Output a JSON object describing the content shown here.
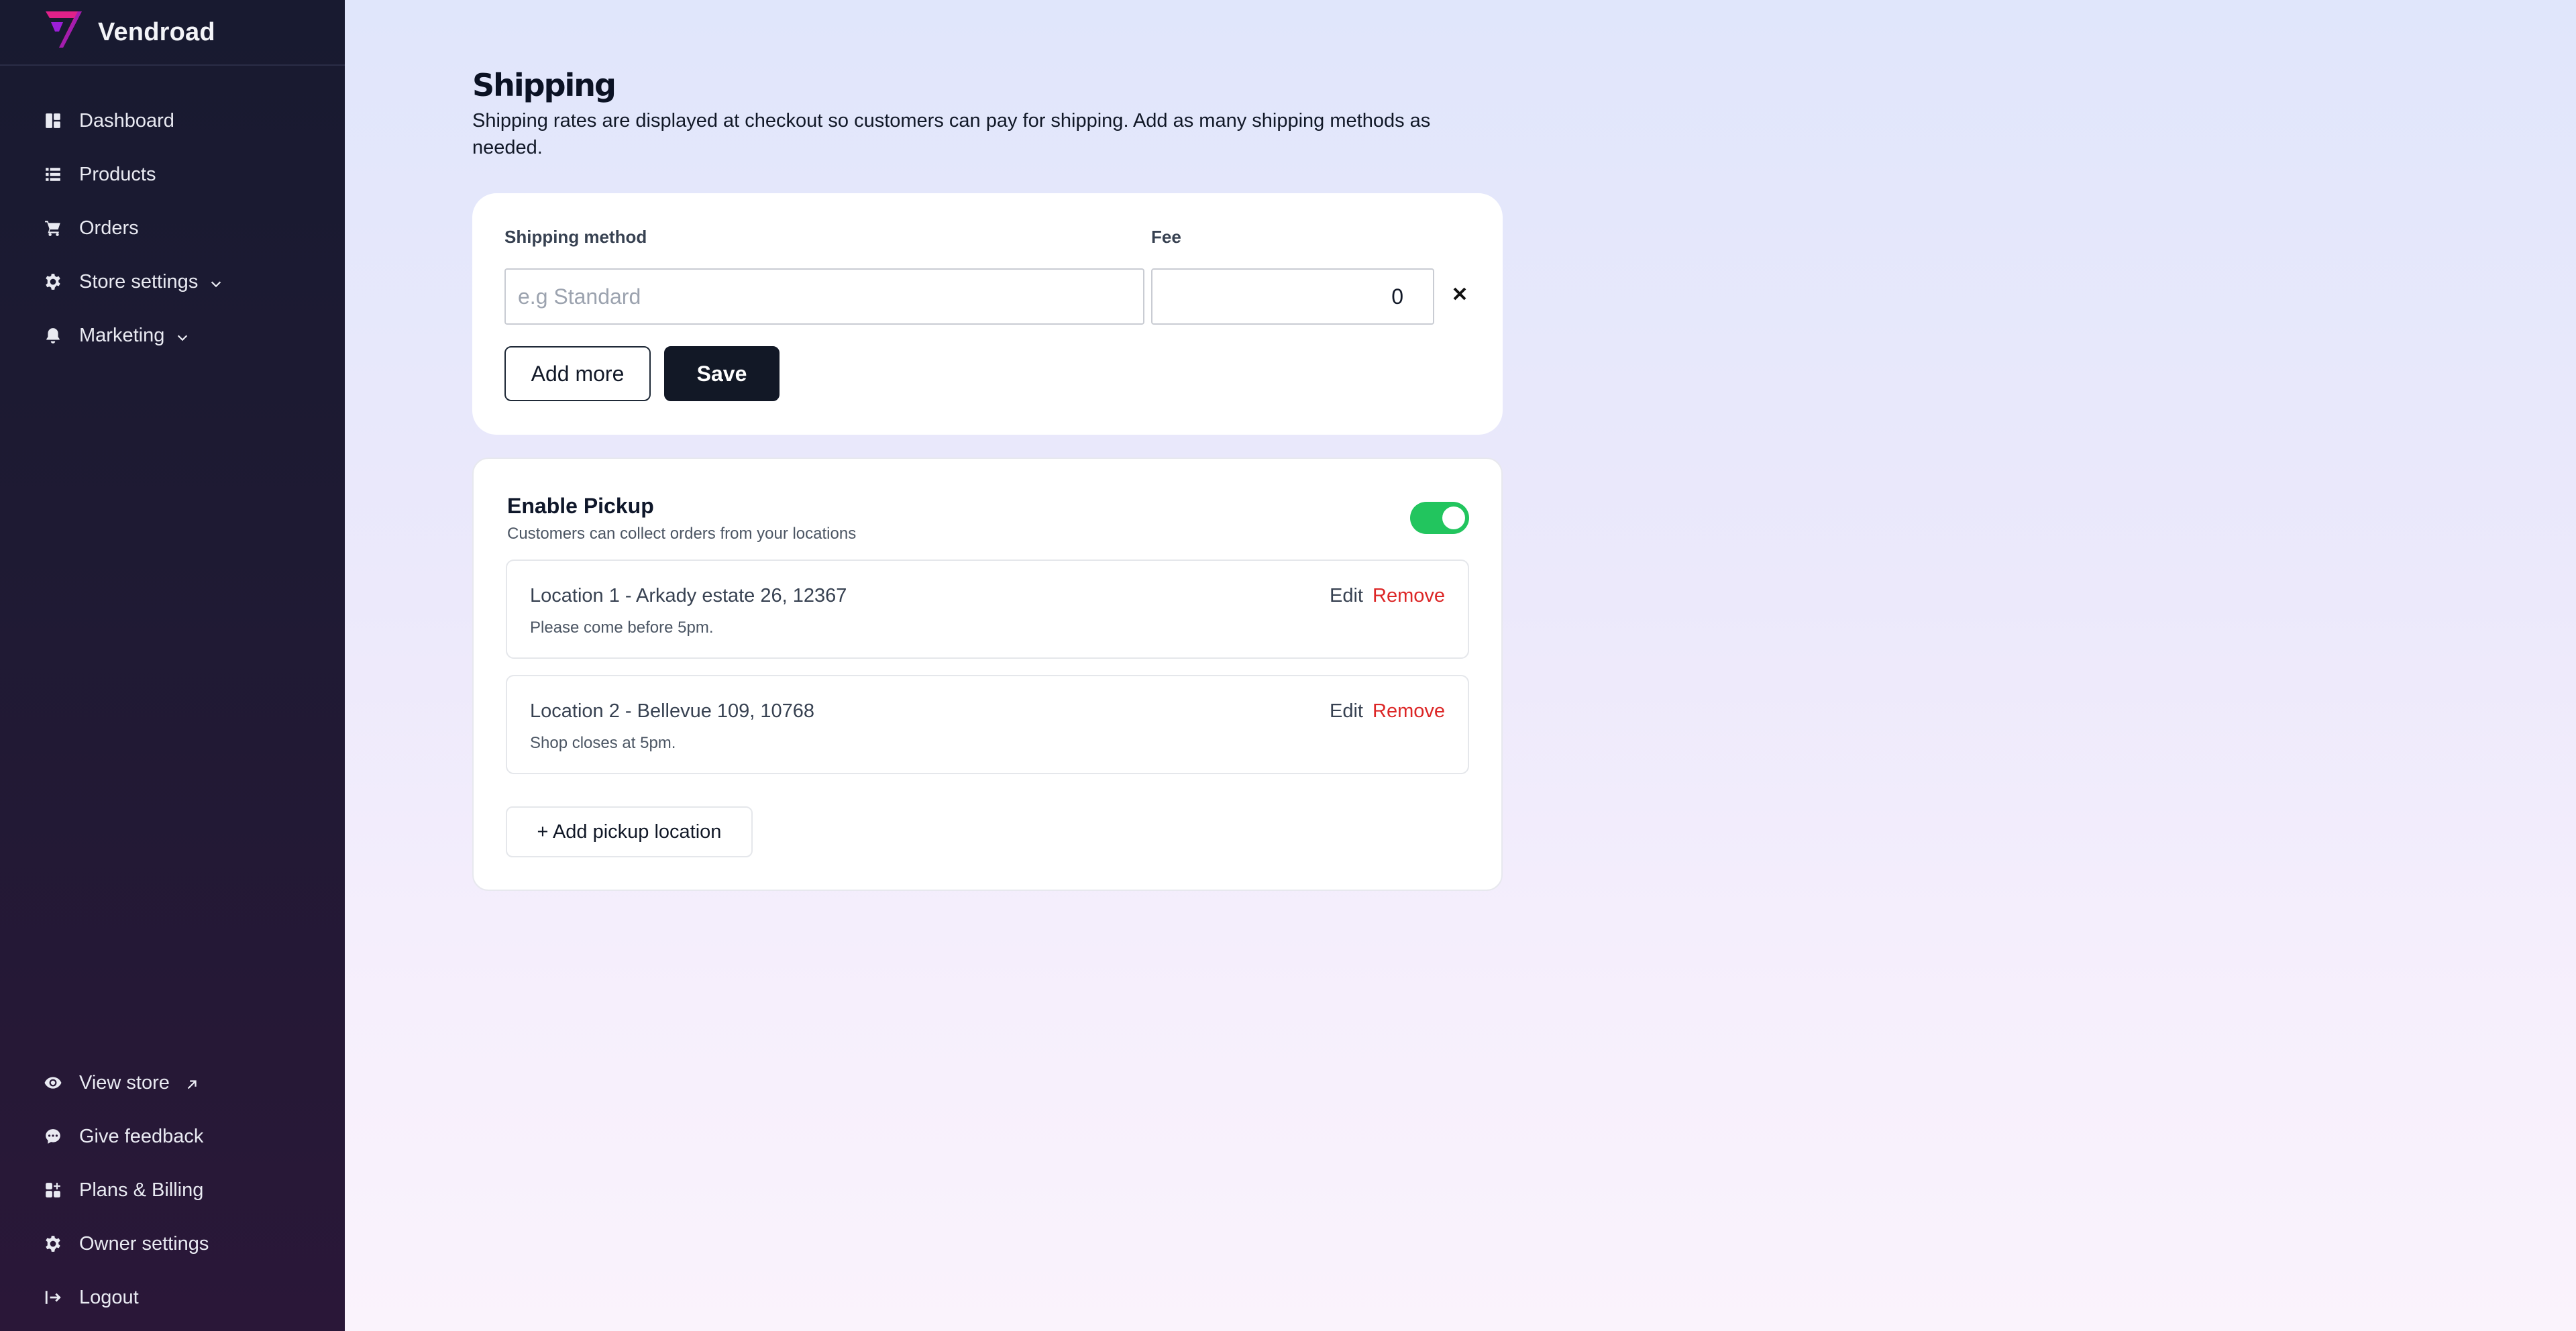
{
  "brand": {
    "name": "Vendroad",
    "logo_colors": [
      "#ff2d8f",
      "#8b1fd6"
    ]
  },
  "sidebar": {
    "items": [
      {
        "label": "Dashboard",
        "icon": "dashboard-icon"
      },
      {
        "label": "Products",
        "icon": "list-icon"
      },
      {
        "label": "Orders",
        "icon": "cart-icon"
      },
      {
        "label": "Store settings",
        "icon": "gear-icon",
        "expandable": true
      },
      {
        "label": "Marketing",
        "icon": "bell-icon",
        "expandable": true
      }
    ],
    "bottom_items": [
      {
        "label": "View store",
        "icon": "eye-icon",
        "external": true
      },
      {
        "label": "Give feedback",
        "icon": "chat-bubble-icon"
      },
      {
        "label": "Plans & Billing",
        "icon": "grid-plus-icon"
      },
      {
        "label": "Owner settings",
        "icon": "gear-icon"
      },
      {
        "label": "Logout",
        "icon": "logout-icon"
      }
    ]
  },
  "page": {
    "title": "Shipping",
    "description": "Shipping rates are displayed at checkout so customers can pay for shipping. Add as many shipping methods as needed."
  },
  "shipping_form": {
    "method_label": "Shipping method",
    "fee_label": "Fee",
    "method_placeholder": "e.g Standard",
    "method_value": "",
    "fee_value": "0",
    "add_more_label": "Add more",
    "save_label": "Save"
  },
  "pickup": {
    "title": "Enable Pickup",
    "subtitle": "Customers can collect orders from your locations",
    "enabled": true,
    "toggle_color": "#22c55e",
    "locations": [
      {
        "title": "Location 1 - Arkady estate 26, 12367",
        "note": "Please come before 5pm."
      },
      {
        "title": "Location 2 - Bellevue 109, 10768",
        "note": "Shop closes at 5pm."
      }
    ],
    "edit_label": "Edit",
    "remove_label": "Remove",
    "add_location_label": "+ Add pickup location"
  }
}
